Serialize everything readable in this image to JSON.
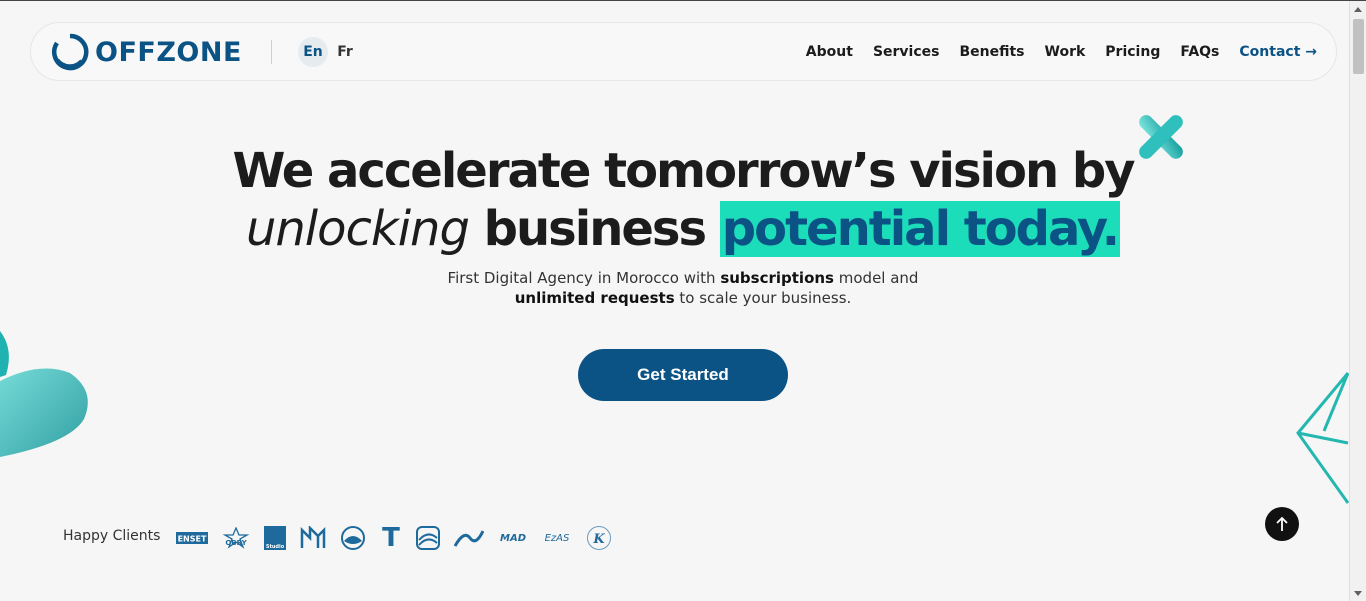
{
  "brand": {
    "name": "OFFZONE",
    "color": "#0b5385"
  },
  "languages": [
    "En",
    "Fr"
  ],
  "nav": {
    "items": [
      "About",
      "Services",
      "Benefits",
      "Work",
      "Pricing",
      "FAQs"
    ],
    "contact": "Contact →"
  },
  "hero": {
    "line1": "We accelerate tomorrow’s vision by",
    "line2_italic": "unlocking",
    "line2_plain": " business ",
    "line2_highlight": "potential today.",
    "highlight_color": "#1cddb9",
    "sub1_a": "First Digital Agency in Morocco with ",
    "sub1_b": "subscriptions",
    "sub1_c": " model and",
    "sub2_a": "unlimited requests",
    "sub2_b": " to scale your business."
  },
  "cta": {
    "label": "Get Started"
  },
  "clients": {
    "label": "Happy Clients",
    "logos": [
      "ENSET",
      "OBRY",
      "Studio",
      "",
      "",
      "T",
      "",
      "",
      "MAD",
      "EzAS",
      "K"
    ]
  },
  "icons": {
    "logo": "offzone-ring-icon",
    "scroll_top": "arrow-up-icon",
    "contact_arrow": "arrow-right-icon"
  }
}
